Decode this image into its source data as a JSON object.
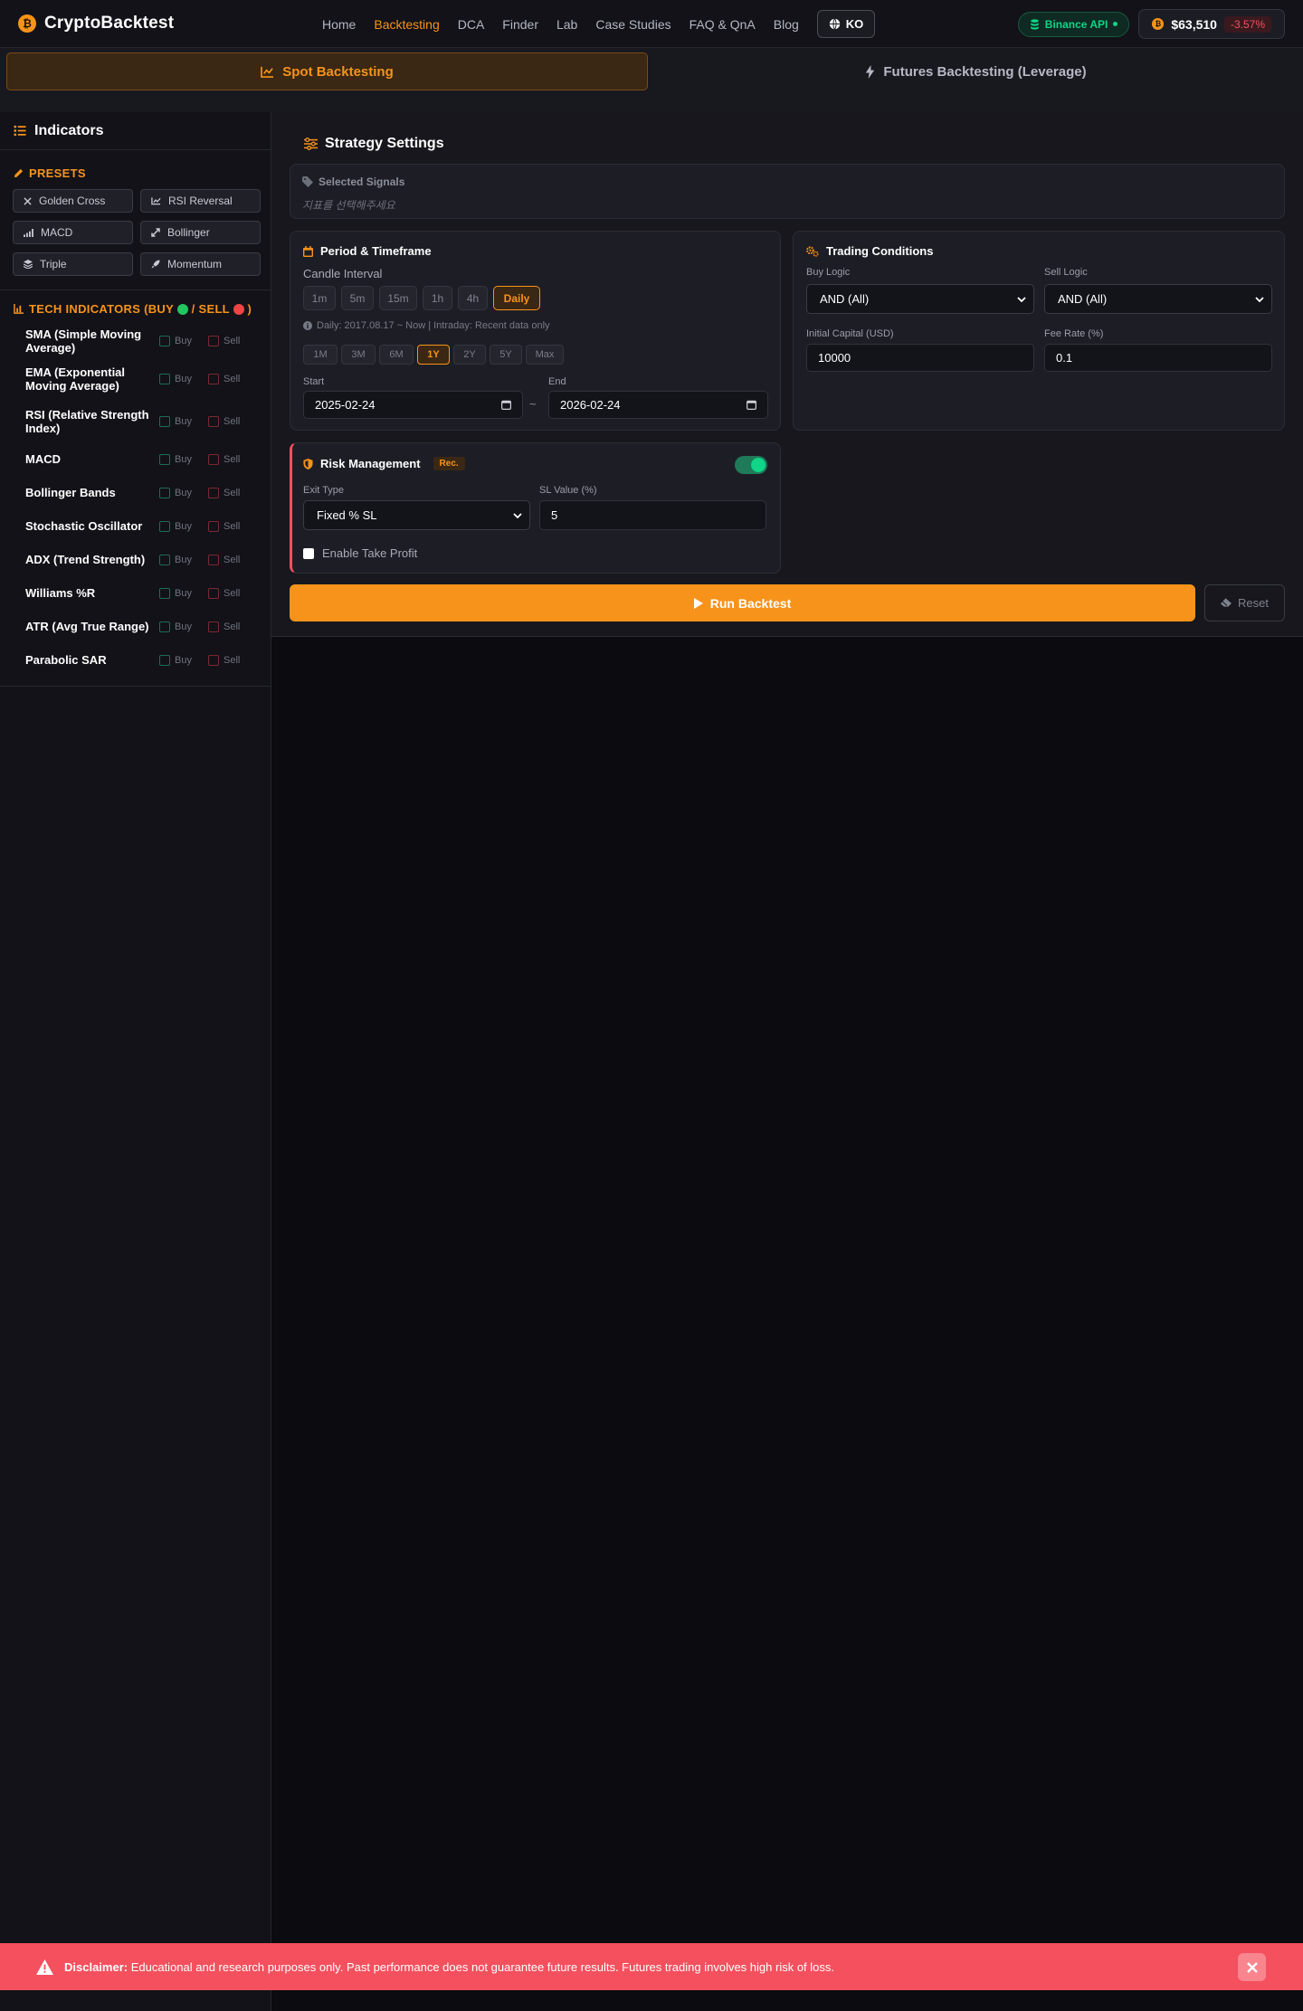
{
  "brand": {
    "coin_symbol": "₿",
    "name": "CryptoBacktest"
  },
  "nav": {
    "links": [
      "Home",
      "Backtesting",
      "DCA",
      "Finder",
      "Lab",
      "Case Studies",
      "FAQ & QnA",
      "Blog"
    ],
    "active": "Backtesting",
    "language": "KO",
    "api_badge": "Binance API",
    "price": "$63,510",
    "price_change": "-3.57%"
  },
  "mode_tabs": {
    "spot": "Spot Backtesting",
    "futures": "Futures Backtesting (Leverage)"
  },
  "sidebar": {
    "title": "Indicators",
    "presets_title": "PRESETS",
    "presets": [
      {
        "label": "Golden Cross",
        "icon": "cross-icon"
      },
      {
        "label": "RSI Reversal",
        "icon": "chart-line-icon"
      },
      {
        "label": "MACD",
        "icon": "signal-bars-icon"
      },
      {
        "label": "Bollinger",
        "icon": "expand-icon"
      },
      {
        "label": "Triple",
        "icon": "layers-icon"
      },
      {
        "label": "Momentum",
        "icon": "rocket-icon"
      }
    ],
    "tech_title_prefix": "TECH INDICATORS (BUY",
    "tech_title_mid": " / SELL",
    "tech_title_suffix": ")",
    "buy_label": "Buy",
    "sell_label": "Sell",
    "indicators": [
      {
        "name": "SMA (Simple Moving Average)"
      },
      {
        "name": "EMA (Exponential Moving Average)"
      },
      {
        "name": "RSI (Relative Strength Index)"
      },
      {
        "name": "MACD"
      },
      {
        "name": "Bollinger Bands"
      },
      {
        "name": "Stochastic Oscillator"
      },
      {
        "name": "ADX (Trend Strength)"
      },
      {
        "name": "Williams %R"
      },
      {
        "name": "ATR (Avg True Range)"
      },
      {
        "name": "Parabolic SAR"
      }
    ]
  },
  "strategy": {
    "title": "Strategy Settings",
    "selected_signals_label": "Selected Signals",
    "selected_signals_placeholder": "지표를 선택해주세요",
    "period": {
      "title": "Period & Timeframe",
      "candle_interval_label": "Candle Interval",
      "intervals": [
        "1m",
        "5m",
        "15m",
        "1h",
        "4h",
        "Daily"
      ],
      "active_interval": "Daily",
      "info": "Daily: 2017.08.17 ~ Now | Intraday: Recent data only",
      "ranges": [
        "1M",
        "3M",
        "6M",
        "1Y",
        "2Y",
        "5Y",
        "Max"
      ],
      "active_range": "1Y",
      "start_label": "Start",
      "start_value": "2025-02-24",
      "end_label": "End",
      "end_value": "2026-02-24",
      "separator": "~"
    },
    "trading": {
      "title": "Trading Conditions",
      "buy_logic_label": "Buy Logic",
      "buy_logic_value": "AND (All)",
      "sell_logic_label": "Sell Logic",
      "sell_logic_value": "AND (All)",
      "capital_label": "Initial Capital (USD)",
      "capital_value": "10000",
      "fee_label": "Fee Rate (%)",
      "fee_value": "0.1"
    },
    "risk": {
      "title": "Risk Management",
      "badge": "Rec.",
      "enabled": true,
      "exit_type_label": "Exit Type",
      "exit_type_value": "Fixed % SL",
      "sl_label": "SL Value (%)",
      "sl_value": "5",
      "take_profit_label": "Enable Take Profit"
    },
    "run_label": "Run Backtest",
    "reset_label": "Reset"
  },
  "disclaimer": {
    "bold": "Disclaimer:",
    "text": " Educational and research purposes only. Past performance does not guarantee future results. Futures trading involves high risk of loss."
  },
  "colors": {
    "accent": "#f7931a",
    "success": "#10d486",
    "danger": "#f4505e",
    "background": "#0b0b10"
  }
}
